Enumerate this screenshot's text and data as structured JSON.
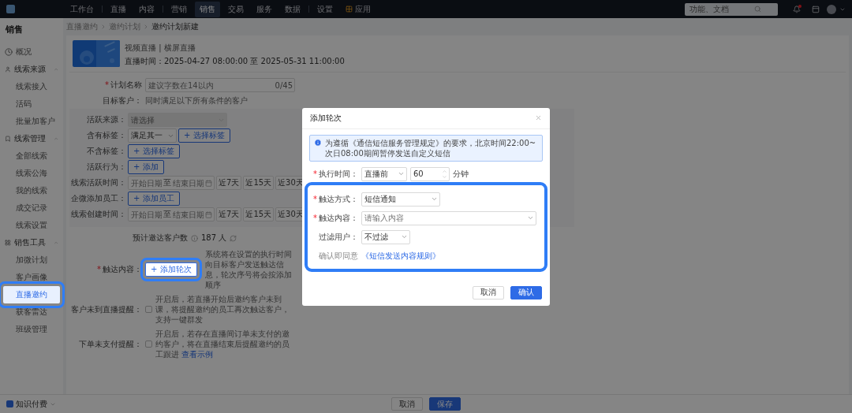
{
  "topbar": {
    "nav": [
      {
        "label": "工作台",
        "selected": false
      },
      {
        "label": "直播",
        "selected": false
      },
      {
        "label": "内容",
        "selected": false
      },
      {
        "label": "营销",
        "selected": false
      },
      {
        "label": "销售",
        "selected": true
      },
      {
        "label": "交易",
        "selected": false
      },
      {
        "label": "服务",
        "selected": false
      },
      {
        "label": "数据",
        "selected": false
      },
      {
        "label": "设置",
        "selected": false
      },
      {
        "label": "应用",
        "selected": false
      }
    ],
    "search": {
      "placeholder": "功能、文档"
    },
    "notification": true
  },
  "sidebar": {
    "title": "销售",
    "items": [
      {
        "label": "概况",
        "selected": false
      },
      {
        "label": "线索来源",
        "expanded": true,
        "children": [
          {
            "label": "线索接入",
            "selected": false,
            "highlighted": false
          },
          {
            "label": "活码",
            "selected": false,
            "highlighted": false
          },
          {
            "label": "批量加客户",
            "selected": false,
            "highlighted": false
          }
        ]
      },
      {
        "label": "线索管理",
        "expanded": true,
        "children": [
          {
            "label": "全部线索",
            "selected": false,
            "highlighted": false
          },
          {
            "label": "线索公海",
            "selected": false,
            "highlighted": false
          },
          {
            "label": "我的线索",
            "selected": false,
            "highlighted": false
          },
          {
            "label": "成交记录",
            "selected": false,
            "highlighted": false
          },
          {
            "label": "线索设置",
            "selected": false,
            "highlighted": false
          }
        ]
      },
      {
        "label": "销售工具",
        "expanded": true,
        "children": [
          {
            "label": "加微计划",
            "selected": false,
            "highlighted": false
          },
          {
            "label": "客户画像",
            "selected": false,
            "highlighted": false
          },
          {
            "label": "直播邀约",
            "selected": true,
            "highlighted": true
          },
          {
            "label": "获客雷达",
            "selected": false,
            "highlighted": false
          },
          {
            "label": "班级管理",
            "selected": false,
            "highlighted": false
          }
        ]
      }
    ]
  },
  "breadcrumb": [
    "直播邀约",
    "邀约计划",
    "邀约计划新建"
  ],
  "live": {
    "type": "视频直播 | 横屏直播",
    "time": "直播时间：2025-04-27 08:00:00 至 2025-05-31 11:00:00"
  },
  "form": {
    "plan_name": {
      "label": "计划名称",
      "required_mark": "*",
      "placeholder": "建议字数在14以内",
      "counter": "0/45"
    },
    "target": {
      "label": "目标客户：",
      "hint": "同时满足以下所有条件的客户",
      "conditions": [
        {
          "kind": "select",
          "label": "活跃来源：",
          "placeholder": "请选择",
          "disabled": true
        },
        {
          "kind": "select_button",
          "label": "含有标签：",
          "value": "满足其一",
          "button": "+ 选择标签"
        },
        {
          "kind": "button",
          "label": "不含标签：",
          "button": "+ 选择标签"
        },
        {
          "kind": "button",
          "label": "活跃行为：",
          "button": "+ 添加"
        },
        {
          "kind": "date_range",
          "label": "线索活跃时间：",
          "start": {
            "placeholder": "开始日期"
          },
          "separator": "至",
          "end": {
            "placeholder": "结束日期"
          },
          "presets": [
            "近7天",
            "近15天",
            "近30天"
          ]
        },
        {
          "kind": "button",
          "label": "企微添加员工：",
          "button": "+ 添加员工"
        },
        {
          "kind": "date_range",
          "label": "线索创建时间：",
          "start": {
            "placeholder": "开始日期"
          },
          "separator": "至",
          "end": {
            "placeholder": "结束日期"
          },
          "presets": [
            "近7天",
            "近15天",
            "近30天"
          ]
        }
      ]
    },
    "estimate": {
      "label": "预计邀达客户数",
      "value": "187 人"
    },
    "reach": {
      "label": "触达内容：",
      "required_mark": "*",
      "button": "+ 添加轮次",
      "highlighted": true,
      "hint": "系统将在设置的执行时间向目标客户发送触达信息，轮次序号将会按添加顺序"
    },
    "reminders": [
      {
        "label": "客户未到直播提醒：",
        "checked": false,
        "text": "开启后，若直播开始后邀约客户未到课，将提醒邀约的员工再次触达客户，支持一键群发"
      },
      {
        "label": "下单未支付提醒：",
        "checked": false,
        "text": "开启后，若存在直播间订单未支付的邀约客户，将在直播结束后提醒邀约的员工跟进",
        "link": "查看示例"
      }
    ]
  },
  "footer": {
    "product": "知识付费",
    "buttons": [
      {
        "label": "取消",
        "primary": false
      },
      {
        "label": "保存",
        "primary": true
      }
    ]
  },
  "modal": {
    "title": "添加轮次",
    "notice": "为遵循《通信短信服务管理规定》的要求，北京时间22:00~次日08:00期间暂停发送自定义短信",
    "exec_time": {
      "label": "执行时间：",
      "required_mark": "*",
      "mode": "直播前",
      "value": "60",
      "unit": "分钟"
    },
    "section": {
      "highlighted": true,
      "fields": [
        {
          "kind": "select",
          "label": "触达方式：",
          "required_mark": "*",
          "value": "短信通知"
        },
        {
          "kind": "wide_select",
          "label": "触达内容：",
          "required_mark": "*",
          "placeholder": "请输入内容"
        },
        {
          "kind": "select",
          "label": "过滤用户：",
          "value": "不过滤"
        }
      ],
      "consent": "确认即同意",
      "consent_link": "《短信发送内容规则》"
    },
    "buttons": [
      {
        "label": "取消",
        "primary": false
      },
      {
        "label": "确认",
        "primary": true
      }
    ]
  }
}
